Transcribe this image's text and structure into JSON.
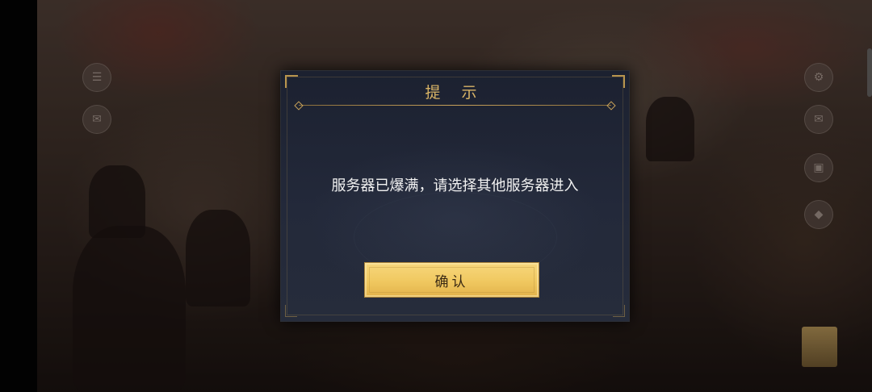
{
  "dialog": {
    "title": "提 示",
    "message": "服务器已爆满，请选择其他服务器进入",
    "confirm_label": "确认"
  },
  "colors": {
    "title_gold": "#d9b466",
    "button_gold": "#f0c860",
    "dialog_bg": "#23293a"
  },
  "icons": {
    "left_buttons": [
      "menu-icon",
      "chat-icon"
    ],
    "right_buttons": [
      "settings-icon",
      "mail-icon",
      "bag-icon",
      "task-icon"
    ]
  }
}
